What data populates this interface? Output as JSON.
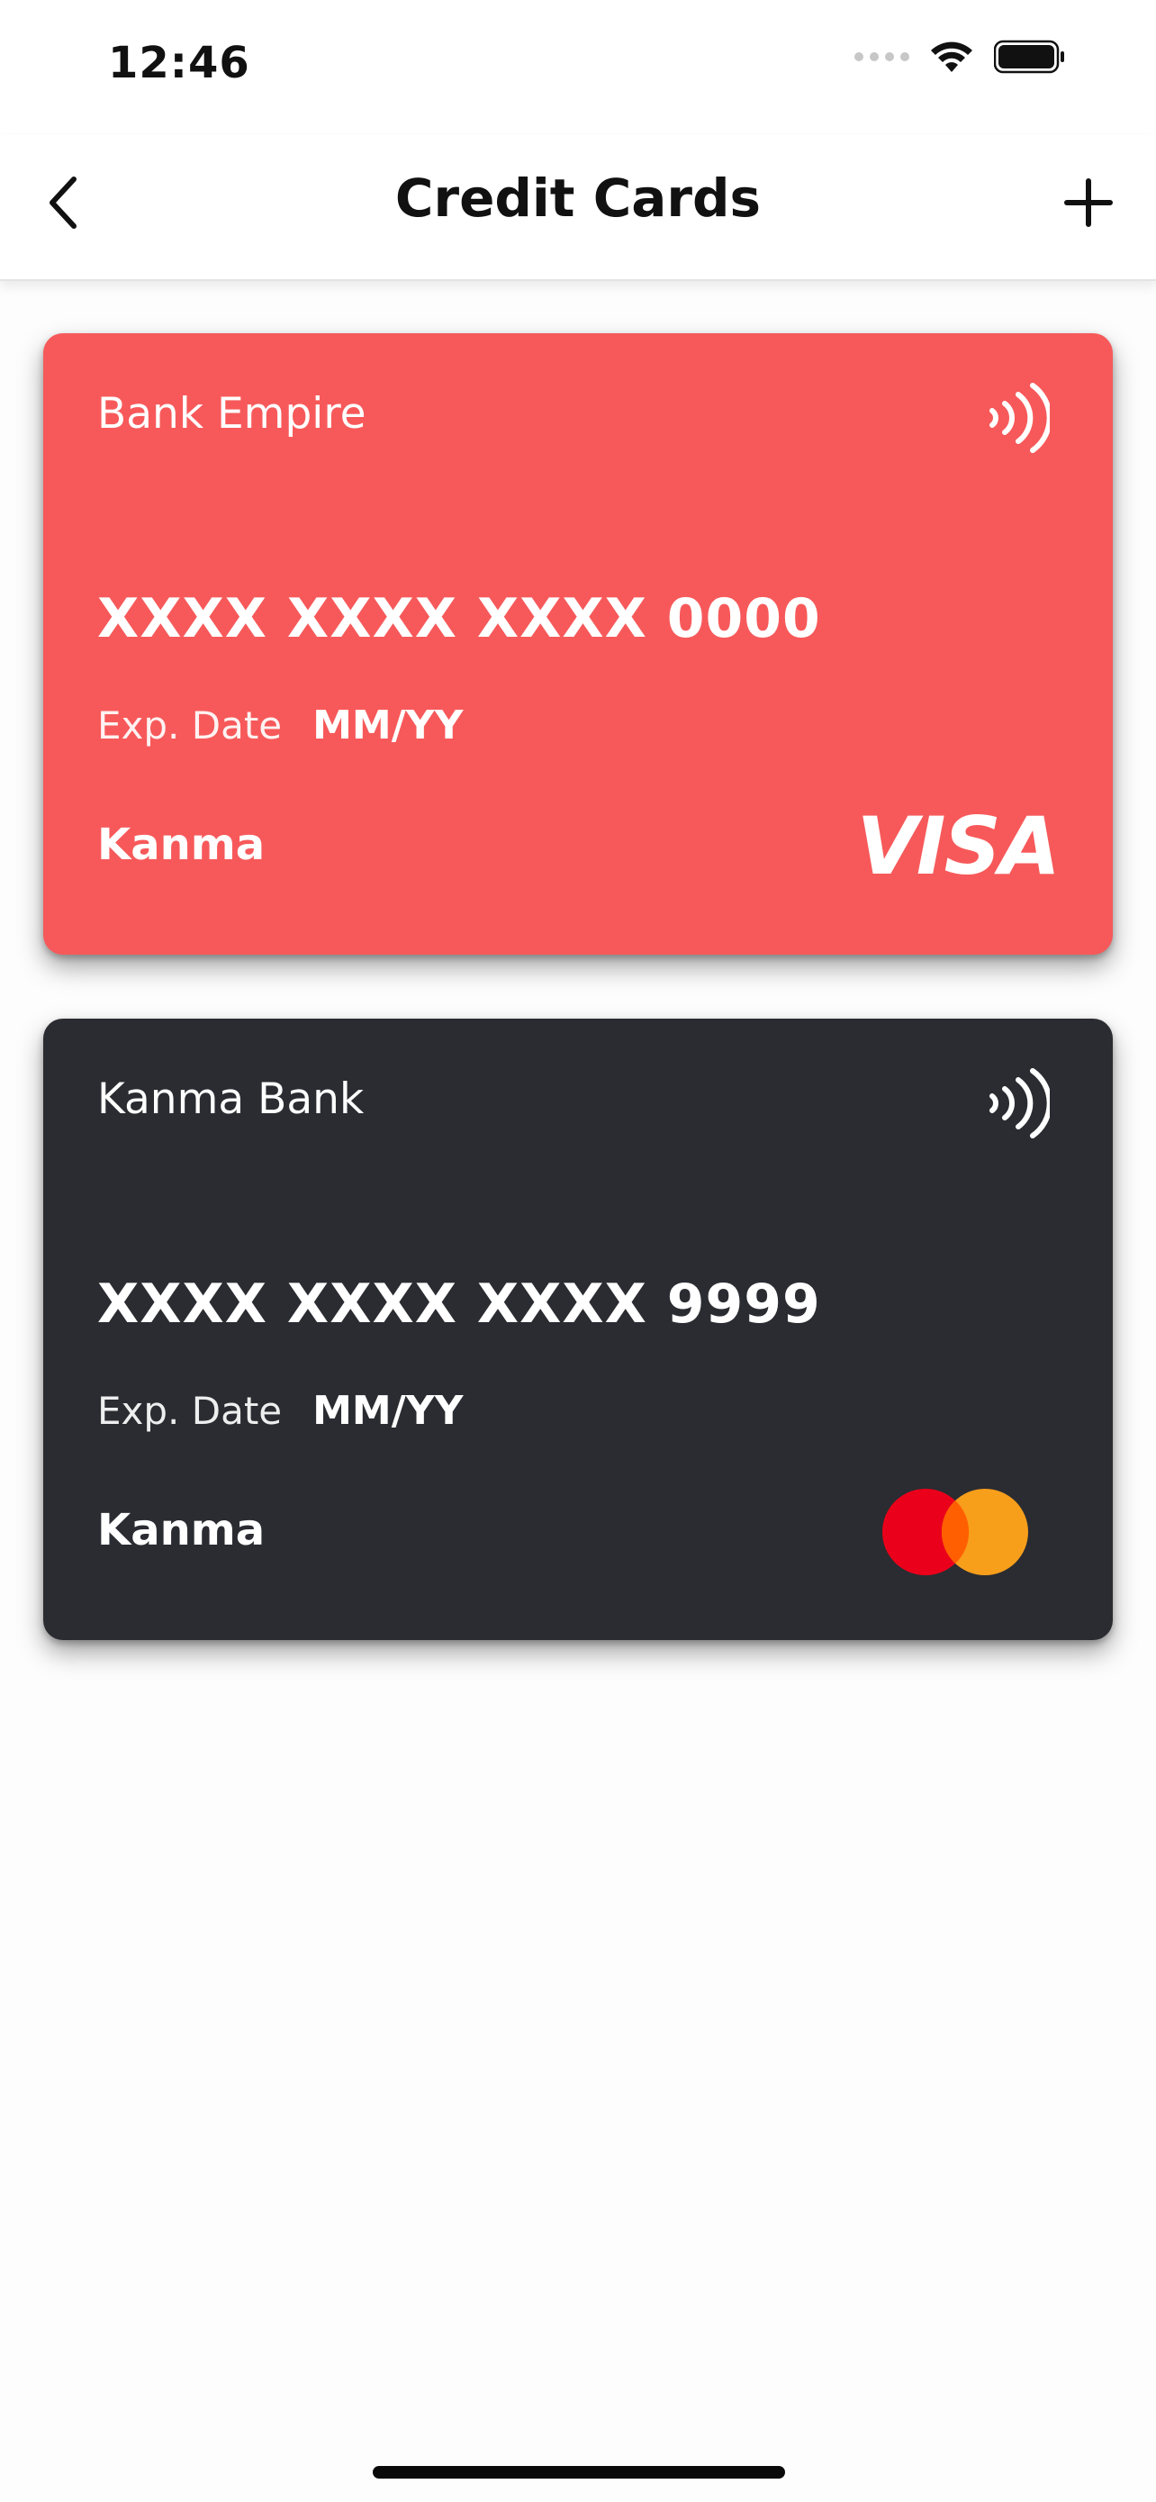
{
  "status_bar": {
    "time": "12:46",
    "icons": [
      "signal-icon",
      "wifi-icon",
      "battery-icon"
    ]
  },
  "nav": {
    "title": "Credit Cards",
    "back_icon": "chevron-left-icon",
    "add_icon": "plus-icon"
  },
  "cards": [
    {
      "bank": "Bank Empire",
      "number": "XXXX XXXX XXXX 0000",
      "exp_label": "Exp. Date",
      "exp_value": "MM/YY",
      "holder": "Kanma",
      "brand": "VISA",
      "color": "#f7595a",
      "contactless_icon": "contactless-icon"
    },
    {
      "bank": "Kanma Bank",
      "number": "XXXX XXXX XXXX 9999",
      "exp_label": "Exp. Date",
      "exp_value": "MM/YY",
      "holder": "Kanma",
      "brand": "mastercard-logo",
      "color": "#2a2c31",
      "contactless_icon": "contactless-icon"
    }
  ],
  "colors": {
    "mastercard_red": "#eb001b",
    "mastercard_orange": "#f79e1b",
    "mastercard_overlap": "#ff5f00"
  }
}
